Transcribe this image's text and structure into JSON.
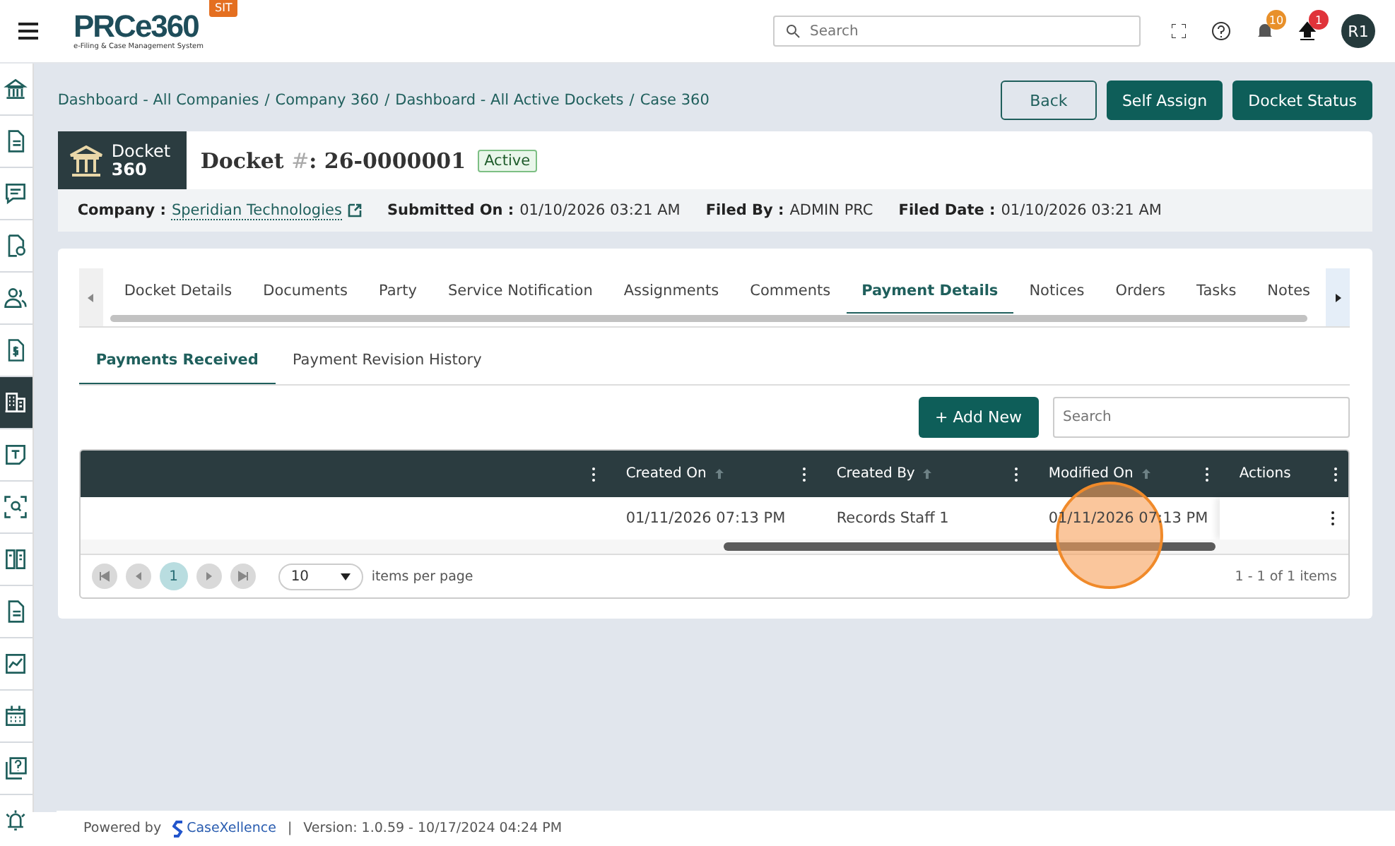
{
  "header": {
    "logo": "PRCe360",
    "logo_subtitle": "e-Filing & Case Management System",
    "env_badge": "SIT",
    "search": {
      "placeholder": "Search"
    },
    "notifications_count": "10",
    "uploads_count": "1",
    "avatar": "R1"
  },
  "sidebar": {
    "items": [
      {
        "selected": false
      },
      {
        "selected": false
      },
      {
        "selected": false
      },
      {
        "selected": false
      },
      {
        "selected": false
      },
      {
        "selected": false
      },
      {
        "selected": true
      },
      {
        "selected": false
      },
      {
        "selected": false
      },
      {
        "selected": false
      },
      {
        "selected": false
      },
      {
        "selected": false
      },
      {
        "selected": false
      },
      {
        "selected": false
      },
      {
        "selected": false
      }
    ]
  },
  "breadcrumb": [
    {
      "label": "Dashboard - All Companies",
      "separator": "/"
    },
    {
      "label": "Company 360",
      "separator": "/"
    },
    {
      "label": "Dashboard - All Active Dockets",
      "separator": "/"
    },
    {
      "label": "Case 360"
    }
  ],
  "actions": [
    {
      "label": "Back",
      "kind": "outline"
    },
    {
      "label": "Self Assign",
      "kind": "primary"
    },
    {
      "label": "Docket Status",
      "kind": "primary"
    }
  ],
  "docket": {
    "badge_line1": "Docket",
    "badge_line2": "360",
    "title_prefix": "Docket",
    "title_mark": "#",
    "title_value": ": 26-0000001",
    "status": "Active",
    "info": [
      {
        "label": "Company :",
        "value": "Speridian Technologies",
        "kind": "link"
      },
      {
        "label": "Submitted On :",
        "value": "01/10/2026 03:21 AM",
        "kind": "text"
      },
      {
        "label": "Filed By :",
        "value": "ADMIN PRC",
        "kind": "text"
      },
      {
        "label": "Filed Date :",
        "value": "01/10/2026 03:21 AM",
        "kind": "text"
      }
    ]
  },
  "tabs": [
    {
      "label": "Docket Details",
      "selected": false
    },
    {
      "label": "Documents",
      "selected": false
    },
    {
      "label": "Party",
      "selected": false
    },
    {
      "label": "Service Notification",
      "selected": false
    },
    {
      "label": "Assignments",
      "selected": false
    },
    {
      "label": "Comments",
      "selected": false
    },
    {
      "label": "Payment Details",
      "selected": true
    },
    {
      "label": "Notices",
      "selected": false
    },
    {
      "label": "Orders",
      "selected": false
    },
    {
      "label": "Tasks",
      "selected": false
    },
    {
      "label": "Notes",
      "selected": false
    }
  ],
  "subtabs": [
    {
      "label": "Payments Received",
      "selected": true
    },
    {
      "label": "Payment Revision History",
      "selected": false
    }
  ],
  "add_button": "+ Add New",
  "table_search": {
    "placeholder": "Search"
  },
  "table": {
    "columns": [
      {
        "sortable": false
      },
      {
        "label": "Created On",
        "sortable": true
      },
      {
        "label": "Created By",
        "sortable": true
      },
      {
        "label": "Modified On",
        "sortable": true
      },
      {
        "label": "Actions",
        "sortable": false
      }
    ],
    "rows": [
      [
        "",
        "01/11/2026 07:13 PM",
        "Records Staff 1",
        "01/11/2026 07:13 PM",
        ""
      ]
    ]
  },
  "pager": {
    "pages": [
      {
        "label": "1",
        "selected": true
      }
    ],
    "page_size": "10",
    "page_size_label": "items per page",
    "summary": "1 - 1 of 1 items"
  },
  "footer": {
    "powered_by": "Powered by",
    "brand": "CaseXellence",
    "separator": "|",
    "version": "Version: 1.0.59 - 10/17/2024 04:24 PM"
  }
}
